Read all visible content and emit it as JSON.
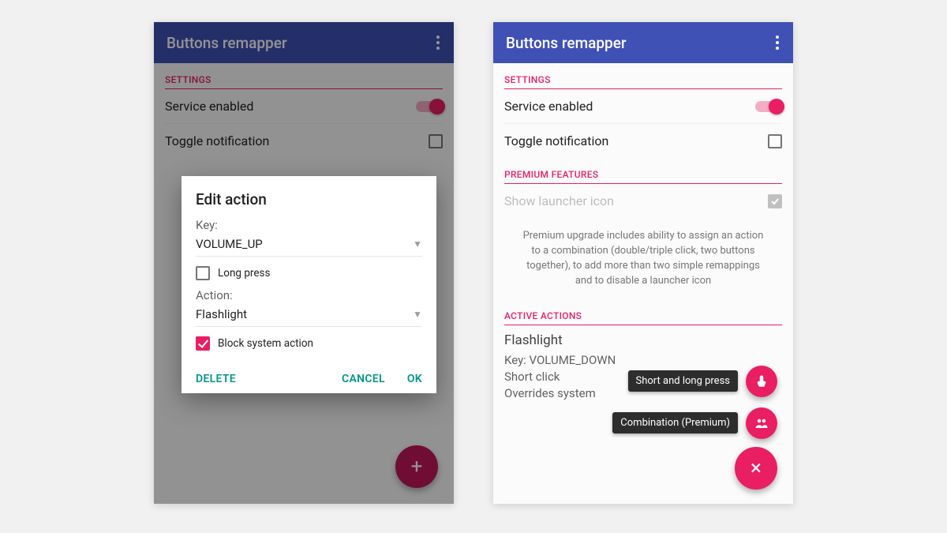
{
  "colors": {
    "primary": "#3f51b5",
    "accent": "#e91e63",
    "teal": "#009688"
  },
  "left": {
    "appbar": {
      "title": "Buttons remapper"
    },
    "sections": {
      "settings": "SETTINGS"
    },
    "service_enabled": {
      "label": "Service enabled",
      "value": true
    },
    "toggle_notification": {
      "label": "Toggle notification",
      "value": false
    },
    "dialog": {
      "title": "Edit action",
      "key_label": "Key:",
      "key_value": "VOLUME_UP",
      "long_press": {
        "label": "Long press",
        "checked": false
      },
      "action_label": "Action:",
      "action_value": "Flashlight",
      "block": {
        "label": "Block system action",
        "checked": true
      },
      "buttons": {
        "delete": "DELETE",
        "cancel": "CANCEL",
        "ok": "OK"
      }
    },
    "fab": "+"
  },
  "right": {
    "appbar": {
      "title": "Buttons remapper"
    },
    "sections": {
      "settings": "SETTINGS",
      "premium": "PREMIUM FEATURES",
      "active": "ACTIVE ACTIONS"
    },
    "service_enabled": {
      "label": "Service enabled",
      "value": true
    },
    "toggle_notification": {
      "label": "Toggle notification",
      "value": false
    },
    "show_launcher": {
      "label": "Show launcher icon",
      "disabled": true,
      "value": true
    },
    "premium_note": "Premium upgrade includes ability to assign an action to a combination (double/triple click, two buttons together), to add more than two simple remappings and to disable a launcher icon",
    "active_action": {
      "title": "Flashlight",
      "key": "Key: VOLUME_DOWN",
      "press": "Short click",
      "override": "Overrides system"
    },
    "fab_labels": {
      "short": "Short and long press",
      "combo": "Combination (Premium)"
    },
    "fab_close": "×"
  }
}
